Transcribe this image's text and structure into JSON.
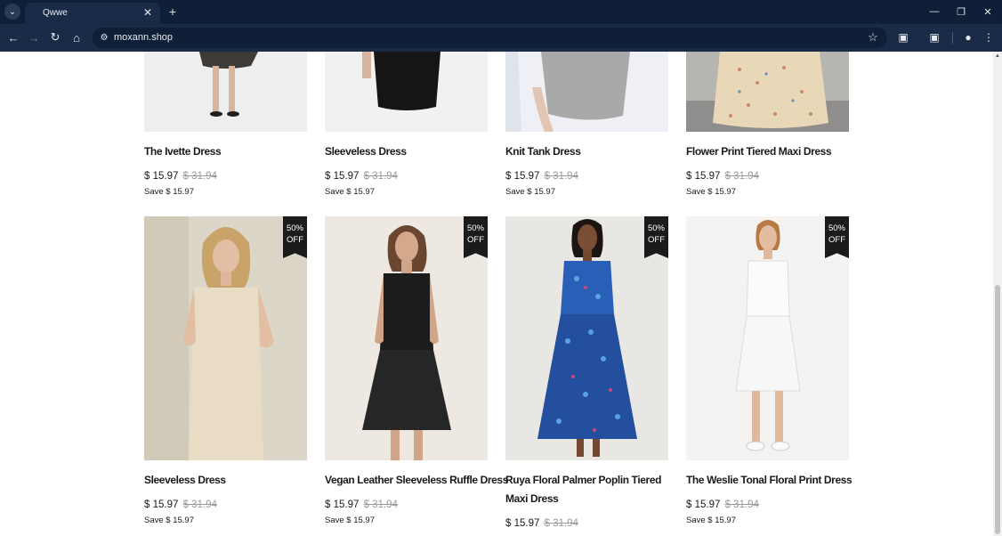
{
  "browser": {
    "tab_title": "Qwwe",
    "url": "moxann.shop"
  },
  "top_row": [
    {
      "name": "The Ivette Dress",
      "price": "$ 15.97",
      "compare_price": "$ 31.94",
      "save": "Save $ 15.97"
    },
    {
      "name": "Sleeveless Dress",
      "price": "$ 15.97",
      "compare_price": "$ 31.94",
      "save": "Save $ 15.97"
    },
    {
      "name": "Knit Tank Dress",
      "price": "$ 15.97",
      "compare_price": "$ 31.94",
      "save": "Save $ 15.97"
    },
    {
      "name": "Flower Print Tiered Maxi Dress",
      "price": "$ 15.97",
      "compare_price": "$ 31.94",
      "save": "Save $ 15.97"
    }
  ],
  "bottom_row": [
    {
      "name": "Sleeveless Dress",
      "price": "$ 15.97",
      "compare_price": "$ 31.94",
      "save": "Save $ 15.97",
      "badge_top": "50%",
      "badge_bottom": "OFF"
    },
    {
      "name": "Vegan Leather Sleeveless Ruffle Dress",
      "price": "$ 15.97",
      "compare_price": "$ 31.94",
      "save": "Save $ 15.97",
      "badge_top": "50%",
      "badge_bottom": "OFF"
    },
    {
      "name": "Ruya Floral Palmer Poplin Tiered Maxi Dress",
      "price": "$ 15.97",
      "compare_price": "$ 31.94",
      "save": "",
      "badge_top": "50%",
      "badge_bottom": "OFF"
    },
    {
      "name": "The Weslie Tonal Floral Print Dress",
      "price": "$ 15.97",
      "compare_price": "$ 31.94",
      "save": "Save $ 15.97",
      "badge_top": "50%",
      "badge_bottom": "OFF"
    }
  ],
  "colors": {
    "chrome_dark": "#0f1f38",
    "chrome_toolbar": "#1a2b47",
    "badge": "#1b1b1b",
    "compare_price": "#9a9a9a"
  }
}
